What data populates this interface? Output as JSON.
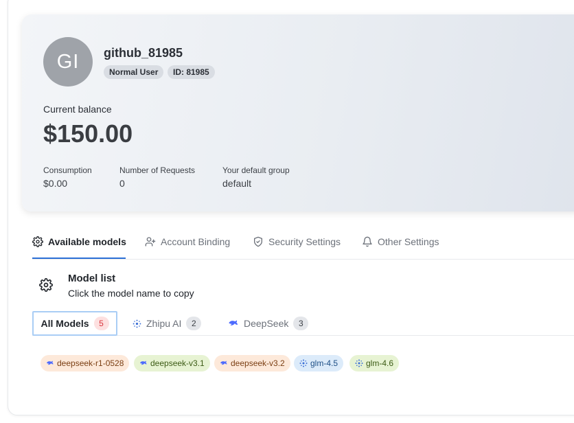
{
  "profile": {
    "avatar_initials": "GI",
    "username": "github_81985",
    "role_badge": "Normal User",
    "id_badge": "ID: 81985",
    "balance_label": "Current balance",
    "balance_value": "$150.00",
    "stats": [
      {
        "label": "Consumption",
        "value": "$0.00"
      },
      {
        "label": "Number of Requests",
        "value": "0"
      },
      {
        "label": "Your default group",
        "value": "default"
      }
    ]
  },
  "tabs": [
    {
      "label": "Available models",
      "icon": "gear-icon",
      "active": true
    },
    {
      "label": "Account Binding",
      "icon": "user-plus-icon"
    },
    {
      "label": "Security Settings",
      "icon": "shield-icon"
    },
    {
      "label": "Other Settings",
      "icon": "bell-icon"
    }
  ],
  "model_list": {
    "icon": "gear-icon",
    "title": "Model list",
    "subtitle": "Click the model name to copy"
  },
  "filters": [
    {
      "label": "All Models",
      "count": "5",
      "active": true
    },
    {
      "label": "Zhipu AI",
      "count": "2",
      "icon": "zhipu-icon"
    },
    {
      "label": "DeepSeek",
      "count": "3",
      "icon": "deepseek-whale-icon"
    }
  ],
  "models": [
    {
      "name": "deepseek-r1-0528",
      "icon": "deepseek-whale-icon",
      "color": "#fde9da"
    },
    {
      "name": "deepseek-v3.1",
      "icon": "deepseek-whale-icon",
      "color": "#e7f3d3"
    },
    {
      "name": "deepseek-v3.2",
      "icon": "deepseek-whale-icon",
      "color": "#fde9da"
    },
    {
      "name": "glm-4.5",
      "icon": "zhipu-icon",
      "color": "#dcebfa"
    },
    {
      "name": "glm-4.6",
      "icon": "zhipu-icon",
      "color": "#e7f3d3"
    }
  ],
  "colors": {
    "accent": "#2b6fd6",
    "avatar_bg": "#9fa3a9",
    "active_filter_border": "#a9cdf5"
  }
}
